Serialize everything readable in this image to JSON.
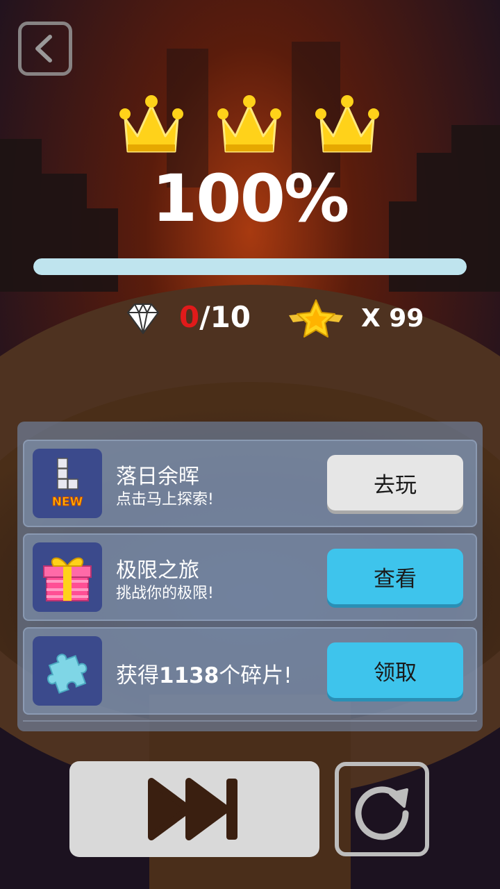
{
  "result": {
    "percent": "100%",
    "progress": 1.0,
    "crowns_earned": 3,
    "crowns_total": 3
  },
  "stats": {
    "gems_current": "0",
    "gems_total": "/10",
    "stars_label": "X 99"
  },
  "offers": [
    {
      "title": "落日余晖",
      "subtitle": "点击马上探索!",
      "button": "去玩",
      "icon": "new-level-icon",
      "icon_badge": "NEW"
    },
    {
      "title": "极限之旅",
      "subtitle": "挑战你的极限!",
      "button": "查看",
      "icon": "gift-icon"
    },
    {
      "title_prefix": "获得",
      "title_number": "1138",
      "title_suffix": "个碎片!",
      "button": "领取",
      "icon": "puzzle-piece-icon"
    }
  ],
  "colors": {
    "crown": "#ffd21a",
    "gem_current": "#e01a1a",
    "button_blue": "#3ec4ec",
    "button_gray": "#e6e6e6",
    "progress": "#bfe4ee"
  }
}
